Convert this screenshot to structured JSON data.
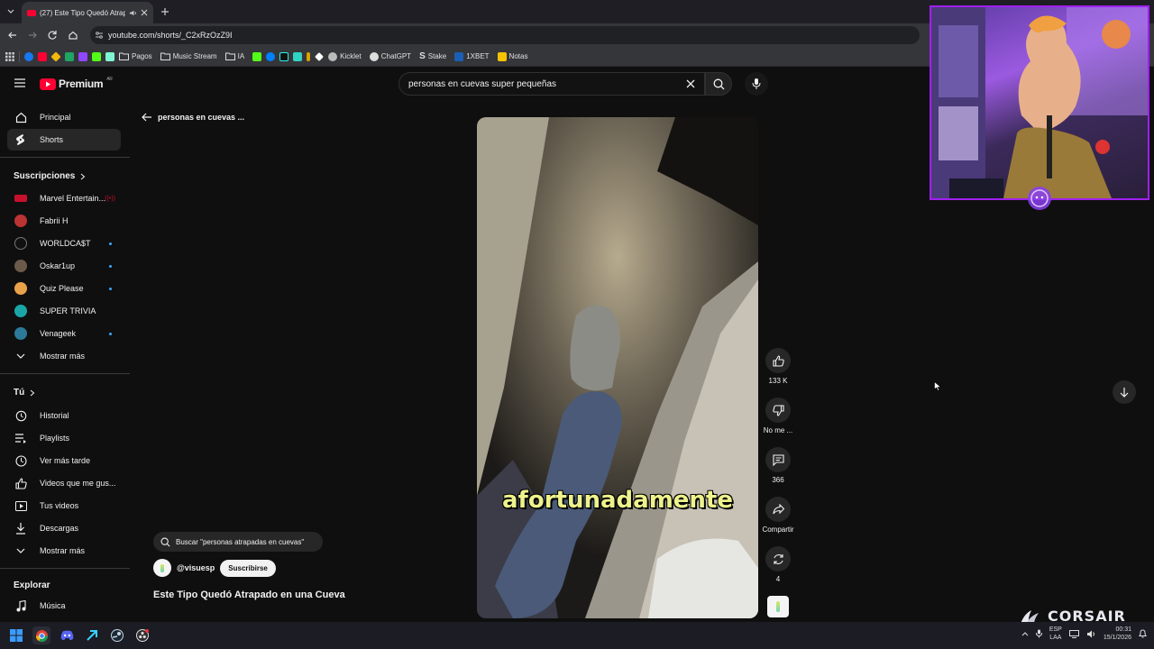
{
  "browser": {
    "tab_title": "(27) Este Tipo Quedó Atrapado",
    "url": "youtube.com/shorts/_C2xRzOzZ9I",
    "bookmarks": [
      "Pagos",
      "Music Stream",
      "IA",
      "Kicklet",
      "ChatGPT",
      "Stake",
      "1XBET",
      "Notas"
    ]
  },
  "youtube": {
    "logo": "Premium",
    "region": "AR",
    "search_value": "personas en cuevas super pequeñas",
    "back_label": "personas en cuevas ...",
    "sidebar": {
      "main": [
        "Principal",
        "Shorts"
      ],
      "subs_header": "Suscripciones",
      "subs": [
        "Marvel Entertain...",
        "Fabrii H",
        "WORLDCA$T",
        "Oskar1up",
        "Quiz Please",
        "SUPER TRIVIA",
        "Venageek"
      ],
      "subs_more": "Mostrar más",
      "you_header": "Tú",
      "you": [
        "Historial",
        "Playlists",
        "Ver más tarde",
        "Videos que me gus...",
        "Tus videos",
        "Descargas"
      ],
      "you_more": "Mostrar más",
      "explore_header": "Explorar",
      "explore": [
        "Música"
      ]
    },
    "short": {
      "caption": "afortunadamente",
      "suggestion": "Buscar \"personas atrapadas en cuevas\"",
      "channel": "@visuesp",
      "subscribe": "Suscribirse",
      "title": "Este Tipo Quedó Atrapado en una Cueva"
    },
    "actions": {
      "likes": "133 K",
      "dislike": "No me ...",
      "comments": "366",
      "share": "Compartir",
      "remix": "4"
    }
  },
  "overlay": {
    "brand": "CORSAIR"
  },
  "taskbar": {
    "lang1": "ESP",
    "lang2": "LAA",
    "time": "00:31",
    "date": "15/1/2026"
  },
  "colors": {
    "yt_red": "#ff0033",
    "accent_blue": "#3ea6ff",
    "cam_border": "#a020f0"
  }
}
